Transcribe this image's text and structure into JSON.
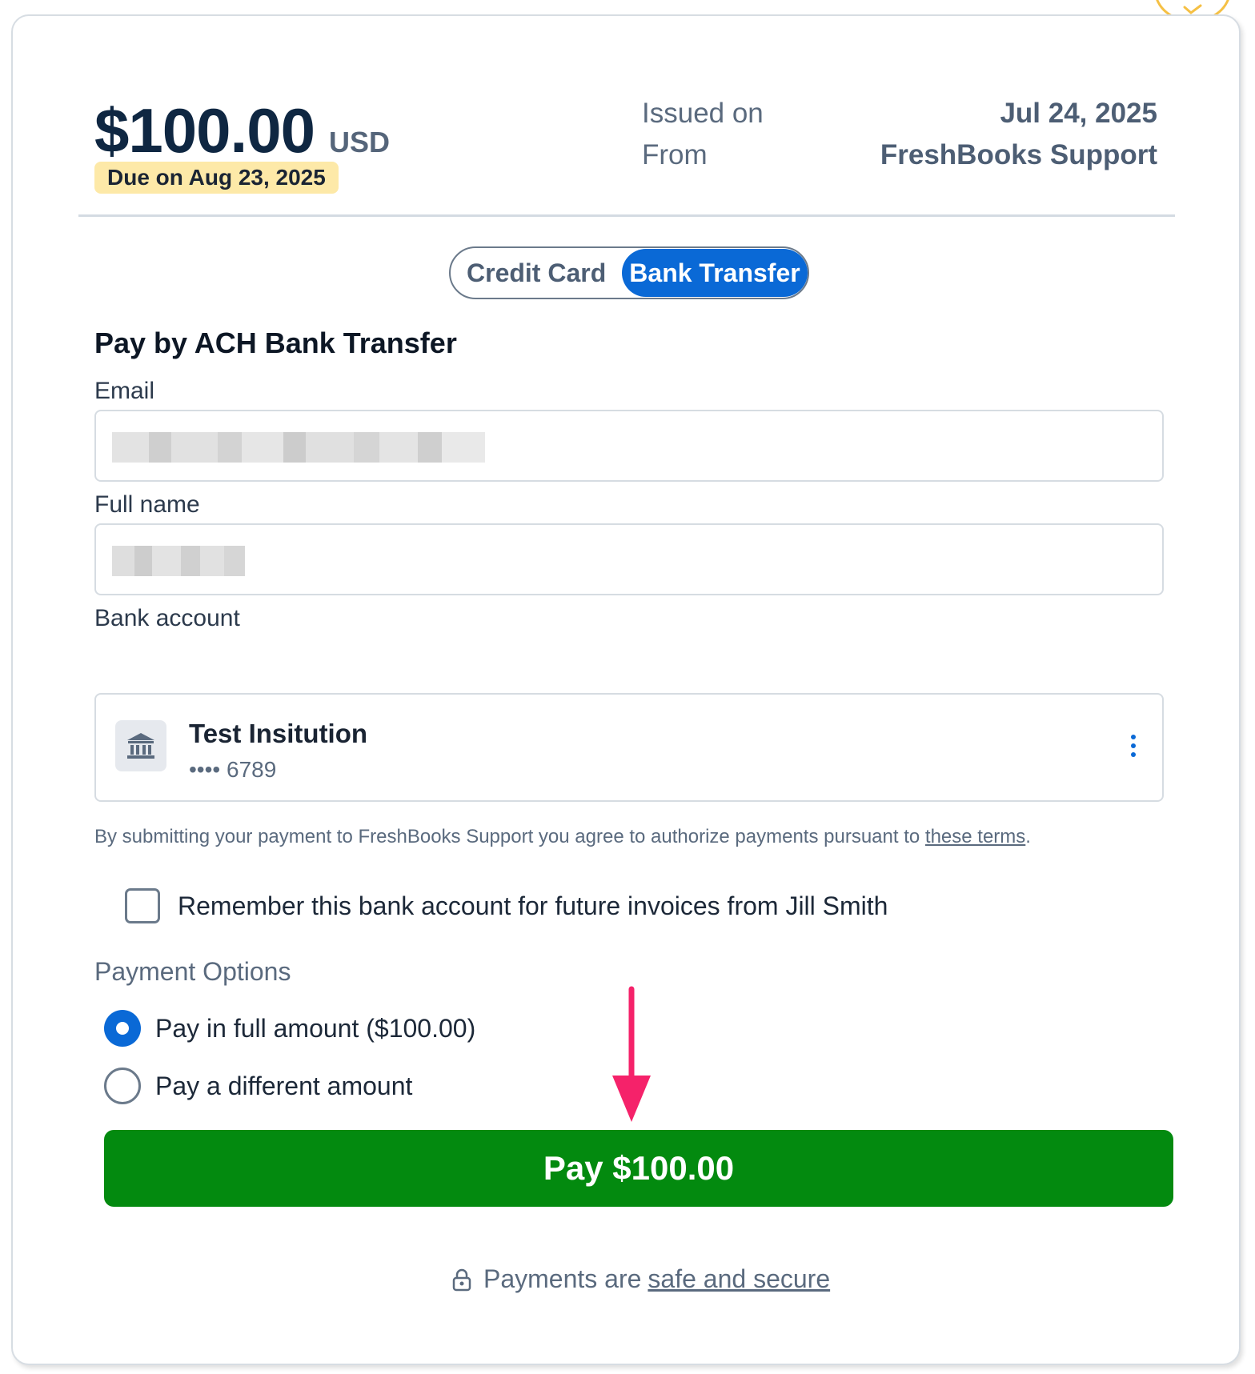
{
  "invoice": {
    "amount": "$100.00",
    "currency": "USD",
    "due": "Due on Aug 23, 2025",
    "issued_label": "Issued on",
    "issued_value": "Jul 24, 2025",
    "from_label": "From",
    "from_value": "FreshBooks Support"
  },
  "tabs": {
    "credit_card": "Credit Card",
    "bank_transfer": "Bank Transfer"
  },
  "form": {
    "section_title": "Pay by ACH Bank Transfer",
    "email_label": "Email",
    "fullname_label": "Full name",
    "bank_label": "Bank account",
    "bank": {
      "name": "Test Insitution",
      "mask": "•••• 6789"
    },
    "terms_text": "By submitting your payment to FreshBooks Support you agree to authorize payments pursuant to ",
    "terms_link": "these terms",
    "terms_end": ".",
    "remember": "Remember this bank account for future invoices from Jill Smith"
  },
  "payment_options": {
    "title": "Payment Options",
    "full": "Pay in full amount ($100.00)",
    "different": "Pay a different amount"
  },
  "pay_button": "Pay $100.00",
  "secure": {
    "prefix": "Payments are",
    "link": "safe and secure"
  },
  "colors": {
    "primary": "#0a69d6",
    "pay_green": "#038a0f",
    "due_badge": "#fde9a8",
    "arrow": "#f5226a"
  }
}
